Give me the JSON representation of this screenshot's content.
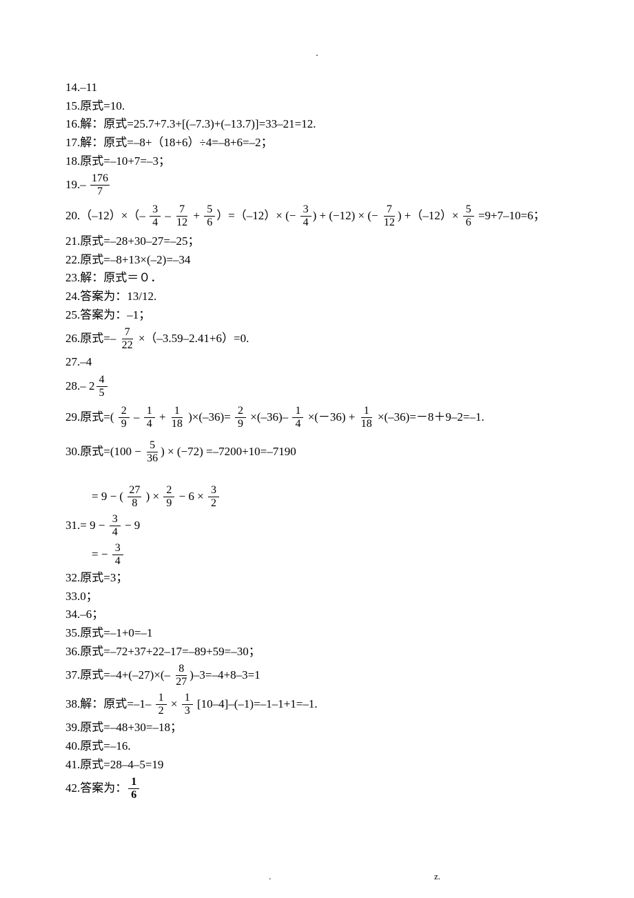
{
  "top_dash": ".",
  "items": {
    "l14": "14.–11",
    "l15": "15.原式=10.",
    "l16": "16.解：原式=25.7+7.3+[(–7.3)+(–13.7)]=33–21=12.",
    "l17": "17.解：原式=–8+（18+6）÷4=–8+6=–2；",
    "l18": "18.原式=–10+7=–3；",
    "l19a": "19.– ",
    "l19_num": "176",
    "l19_den": "7",
    "l20a": "20.（–12）×（– ",
    "l20f1n": "3",
    "l20f1d": "4",
    "l20b": " – ",
    "l20f2n": "7",
    "l20f2d": "12",
    "l20c": " + ",
    "l20f3n": "5",
    "l20f3d": "6",
    "l20d": "）=（–12）× (− ",
    "l20f4n": "3",
    "l20f4d": "4",
    "l20e": ") + (−12) × (− ",
    "l20f5n": "7",
    "l20f5d": "12",
    "l20f": ") +（–12）× ",
    "l20f6n": "5",
    "l20f6d": "6",
    "l20g": " =9+7–10=6；",
    "l21": "21.原式=–28+30–27=–25；",
    "l22": "22.原式=–8+13×(–2)=–34",
    "l23": "23.解：原式＝０．",
    "l24": "24.答案为：13/12.",
    "l25": "25.答案为：–1；",
    "l26a": "26.原式=– ",
    "l26n": "7",
    "l26d": "22",
    "l26b": " ×（–3.59–2.41+6）=0.",
    "l27": "27.–4",
    "l28a": "28.– 2",
    "l28n": "4",
    "l28d": "5",
    "l29a": "29.原式=( ",
    "l29f1n": "2",
    "l29f1d": "9",
    "l29b": " – ",
    "l29f2n": "1",
    "l29f2d": "4",
    "l29c": " + ",
    "l29f3n": "1",
    "l29f3d": "18",
    "l29d": " )×(–36)= ",
    "l29f4n": "2",
    "l29f4d": "9",
    "l29e": " ×(–36)– ",
    "l29f5n": "1",
    "l29f5d": "4",
    "l29f": " ×(－36) + ",
    "l29f6n": "1",
    "l29f6d": "18",
    "l29g": " ×(–36)=－8＋9–2=–1.",
    "l30a": "30.原式=(100 − ",
    "l30n": "5",
    "l30d": "36",
    "l30b": ") × (−72) =–7200+10=–7190",
    "s31_1a": "= 9 − ( ",
    "s31_1f1n": "27",
    "s31_1f1d": "8",
    "s31_1b": " ) × ",
    "s31_1f2n": "2",
    "s31_1f2d": "9",
    "s31_1c": " − 6 × ",
    "s31_1f3n": "3",
    "s31_1f3d": "2",
    "l31a": "31.= 9 − ",
    "l31f1n": "3",
    "l31f1d": "4",
    "l31b": " − 9",
    "s31_3a": "= − ",
    "s31_3n": "3",
    "s31_3d": "4",
    "l32": "32.原式=3；",
    "l33": "33.0；",
    "l34": "34.–6；",
    "l35": "35.原式=–1+0=–1",
    "l36": "36.原式=–72+37+22–17=–89+59=–30；",
    "l37a": "37.原式=–4+(–27)×(– ",
    "l37n": "8",
    "l37d": "27",
    "l37b": ")–3=–4+8–3=1",
    "l38a": "38.解：原式=–1– ",
    "l38f1n": "1",
    "l38f1d": "2",
    "l38b": " × ",
    "l38f2n": "1",
    "l38f2d": "3",
    "l38c": " [10–4]–(–1)=–1–1+1=–1.",
    "l39": "39.原式=–48+30=–18；",
    "l40": "40.原式=–16.",
    "l41": "41.原式=28–4–5=19",
    "l42a": "42.答案为：",
    "l42n": "1",
    "l42d": "6"
  },
  "footer": {
    "dot": ".",
    "z": "z."
  }
}
